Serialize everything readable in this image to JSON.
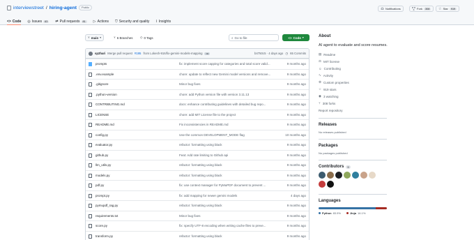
{
  "repo": {
    "owner": "interviewstreet",
    "separator": "/",
    "name": "hiring-agent",
    "visibility": "Public"
  },
  "header_actions": {
    "notifications": "Notifications",
    "fork": {
      "label": "Fork",
      "count": "308"
    },
    "star": {
      "label": "Star",
      "count": "919"
    }
  },
  "tabs": [
    {
      "label": "Code",
      "count": ""
    },
    {
      "label": "Issues",
      "count": "63"
    },
    {
      "label": "Pull requests",
      "count": "81"
    },
    {
      "label": "Actions",
      "count": ""
    },
    {
      "label": "Security and quality",
      "count": ""
    },
    {
      "label": "Insights",
      "count": ""
    }
  ],
  "toolbar": {
    "branch": "main",
    "branches": "6 Branches",
    "tags": "0 Tags",
    "search_placeholder": "Go to file",
    "code_button": "Code"
  },
  "commit": {
    "author": "sp2hari",
    "message_prefix": "Merge pull request",
    "pr_link": "#195",
    "message_rest": "from Lokesh-916/fix-gemini-models-mapping",
    "ellipsis": "•••",
    "hash": "b4750c5 · 4 days ago",
    "commits": "65 Commits"
  },
  "files": [
    {
      "type": "folder",
      "name": "prompts",
      "message": "fix: implement score capping for categories and total score valid...",
      "age": "9 months ago"
    },
    {
      "type": "file",
      "name": ".env.example",
      "message": "chore: update to reflect new Gemini model versions and remove...",
      "age": "9 months ago"
    },
    {
      "type": "file",
      "name": ".gitignore",
      "message": "Minor bug fixes",
      "age": "9 months ago"
    },
    {
      "type": "file",
      "name": ".python-version",
      "message": "chore: add Python version file with version 3.11.13",
      "age": "9 months ago"
    },
    {
      "type": "file",
      "name": "CONTRIBUTING.md",
      "message": "docs: enhance contributing guidelines with detailed bug repo...",
      "age": "9 months ago"
    },
    {
      "type": "file",
      "name": "LICENSE",
      "message": "chore: add MIT License file to the project",
      "age": "9 months ago"
    },
    {
      "type": "file",
      "name": "README.md",
      "message": "Fix inconsistencies in README.md",
      "age": "9 months ago"
    },
    {
      "type": "file",
      "name": "config.py",
      "message": "Use the common DEVELOPMENT_MODE flag",
      "age": "10 months ago"
    },
    {
      "type": "file",
      "name": "evaluator.py",
      "message": "refactor: formatting using black",
      "age": "9 months ago"
    },
    {
      "type": "file",
      "name": "github.py",
      "message": "Feat: Add rate limiting to Github api",
      "age": "9 months ago"
    },
    {
      "type": "file",
      "name": "llm_utils.py",
      "message": "refactor: formatting using black",
      "age": "9 months ago"
    },
    {
      "type": "file",
      "name": "models.py",
      "message": "refactor: formatting using black",
      "age": "9 months ago"
    },
    {
      "type": "file",
      "name": "pdf.py",
      "message": "fix: use context manager for PyMuPDF document to prevent ...",
      "age": "9 months ago"
    },
    {
      "type": "file",
      "name": "prompt.py",
      "message": "fix: add mapping for newer gemini models",
      "age": "4 days ago"
    },
    {
      "type": "file",
      "name": "pymupdf_rag.py",
      "message": "refactor: formatting using black",
      "age": "9 months ago"
    },
    {
      "type": "file",
      "name": "requirements.txt",
      "message": "Minor bug fixes",
      "age": "9 months ago"
    },
    {
      "type": "file",
      "name": "score.py",
      "message": "fix: specify UTF-8 encoding when writing cache files to preve...",
      "age": "9 months ago"
    },
    {
      "type": "file",
      "name": "transform.py",
      "message": "refactor: formatting using black",
      "age": "9 months ago"
    }
  ],
  "about": {
    "heading": "About",
    "description": "AI agent to evaluate and score resumes.",
    "items": [
      {
        "icon": "book-icon",
        "label": "Readme"
      },
      {
        "icon": "law-icon",
        "label": "MIT license"
      },
      {
        "icon": "people-icon",
        "label": "Contributing"
      },
      {
        "icon": "pulse-icon",
        "label": "Activity"
      },
      {
        "icon": "gear-icon",
        "label": "Custom properties"
      },
      {
        "icon": "star-icon",
        "label": "919 stars"
      },
      {
        "icon": "eye-icon",
        "label": "3 watching"
      },
      {
        "icon": "fork-icon",
        "label": "308 forks"
      }
    ],
    "report": "Report repository"
  },
  "releases": {
    "heading": "Releases",
    "text": "No releases published"
  },
  "packages": {
    "heading": "Packages",
    "text": "No packages published"
  },
  "contributors": {
    "heading": "Contributors",
    "count": "9"
  },
  "languages": {
    "heading": "Languages",
    "items": [
      {
        "name": "Python",
        "percent": "83.9%",
        "value": 83.9,
        "color": "#3572A5"
      },
      {
        "name": "Jinja",
        "percent": "16.1%",
        "value": 16.1,
        "color": "#a52a22"
      }
    ]
  },
  "colors": {
    "accent": "#0969da",
    "code_button": "#1f883d",
    "folder": "#54aeff",
    "tab_underline": "#fd8c73"
  }
}
